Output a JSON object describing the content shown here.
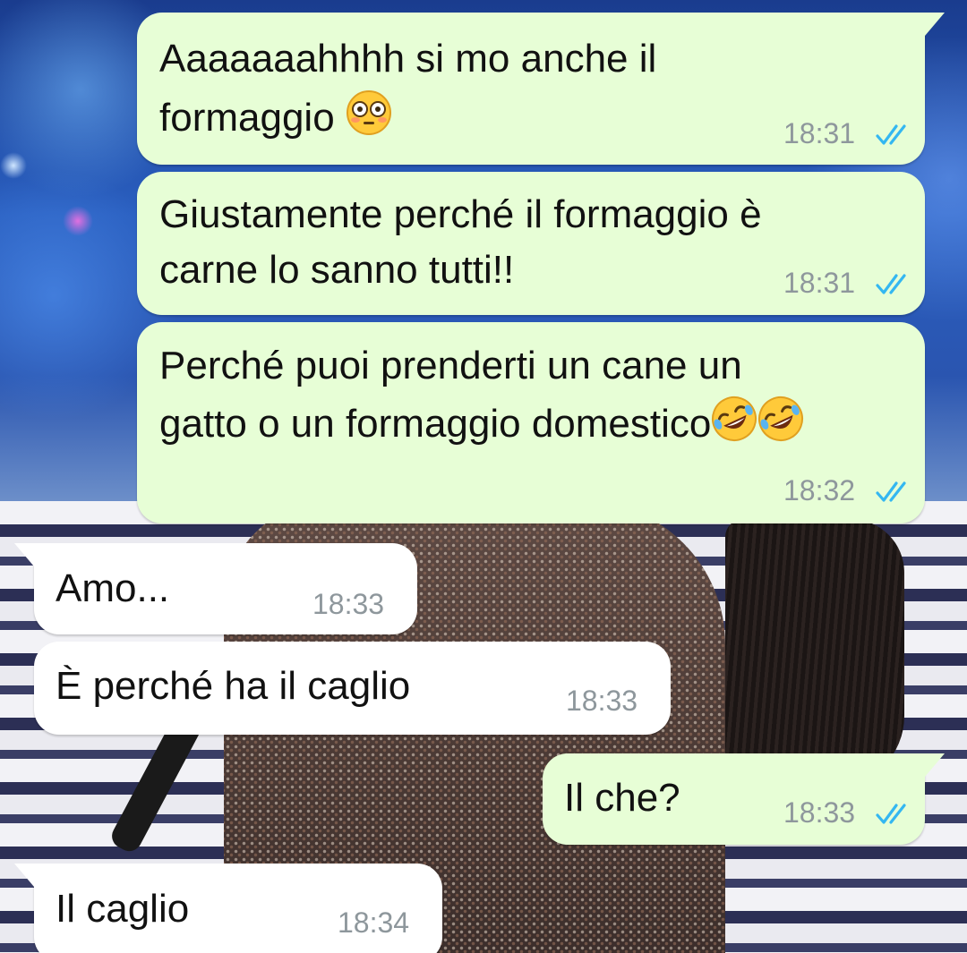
{
  "colors": {
    "outgoing_bubble": "#e7fed6",
    "incoming_bubble": "#ffffff",
    "timestamp": "#8e979c",
    "read_ticks": "#34b7f1"
  },
  "messages": [
    {
      "direction": "outgoing",
      "lines": [
        "Aaaaaaahhhh si mo anche il",
        "formaggio"
      ],
      "emoji": "flushed-face",
      "time": "18:31",
      "status": "read"
    },
    {
      "direction": "outgoing",
      "lines": [
        "Giustamente perché il formaggio è",
        "carne lo sanno tutti!!"
      ],
      "time": "18:31",
      "status": "read"
    },
    {
      "direction": "outgoing",
      "lines": [
        "Perché puoi prenderti un cane un",
        "gatto o un formaggio domestico"
      ],
      "emoji": "rolling-on-floor-laughing-face x2",
      "time": "18:32",
      "status": "read"
    },
    {
      "direction": "incoming",
      "lines": [
        "Amo..."
      ],
      "time": "18:33"
    },
    {
      "direction": "incoming",
      "lines": [
        "È perché ha il caglio"
      ],
      "time": "18:33"
    },
    {
      "direction": "outgoing",
      "lines": [
        "Il che?"
      ],
      "time": "18:33",
      "status": "read"
    },
    {
      "direction": "incoming",
      "lines": [
        "Il caglio"
      ],
      "time": "18:34"
    }
  ]
}
